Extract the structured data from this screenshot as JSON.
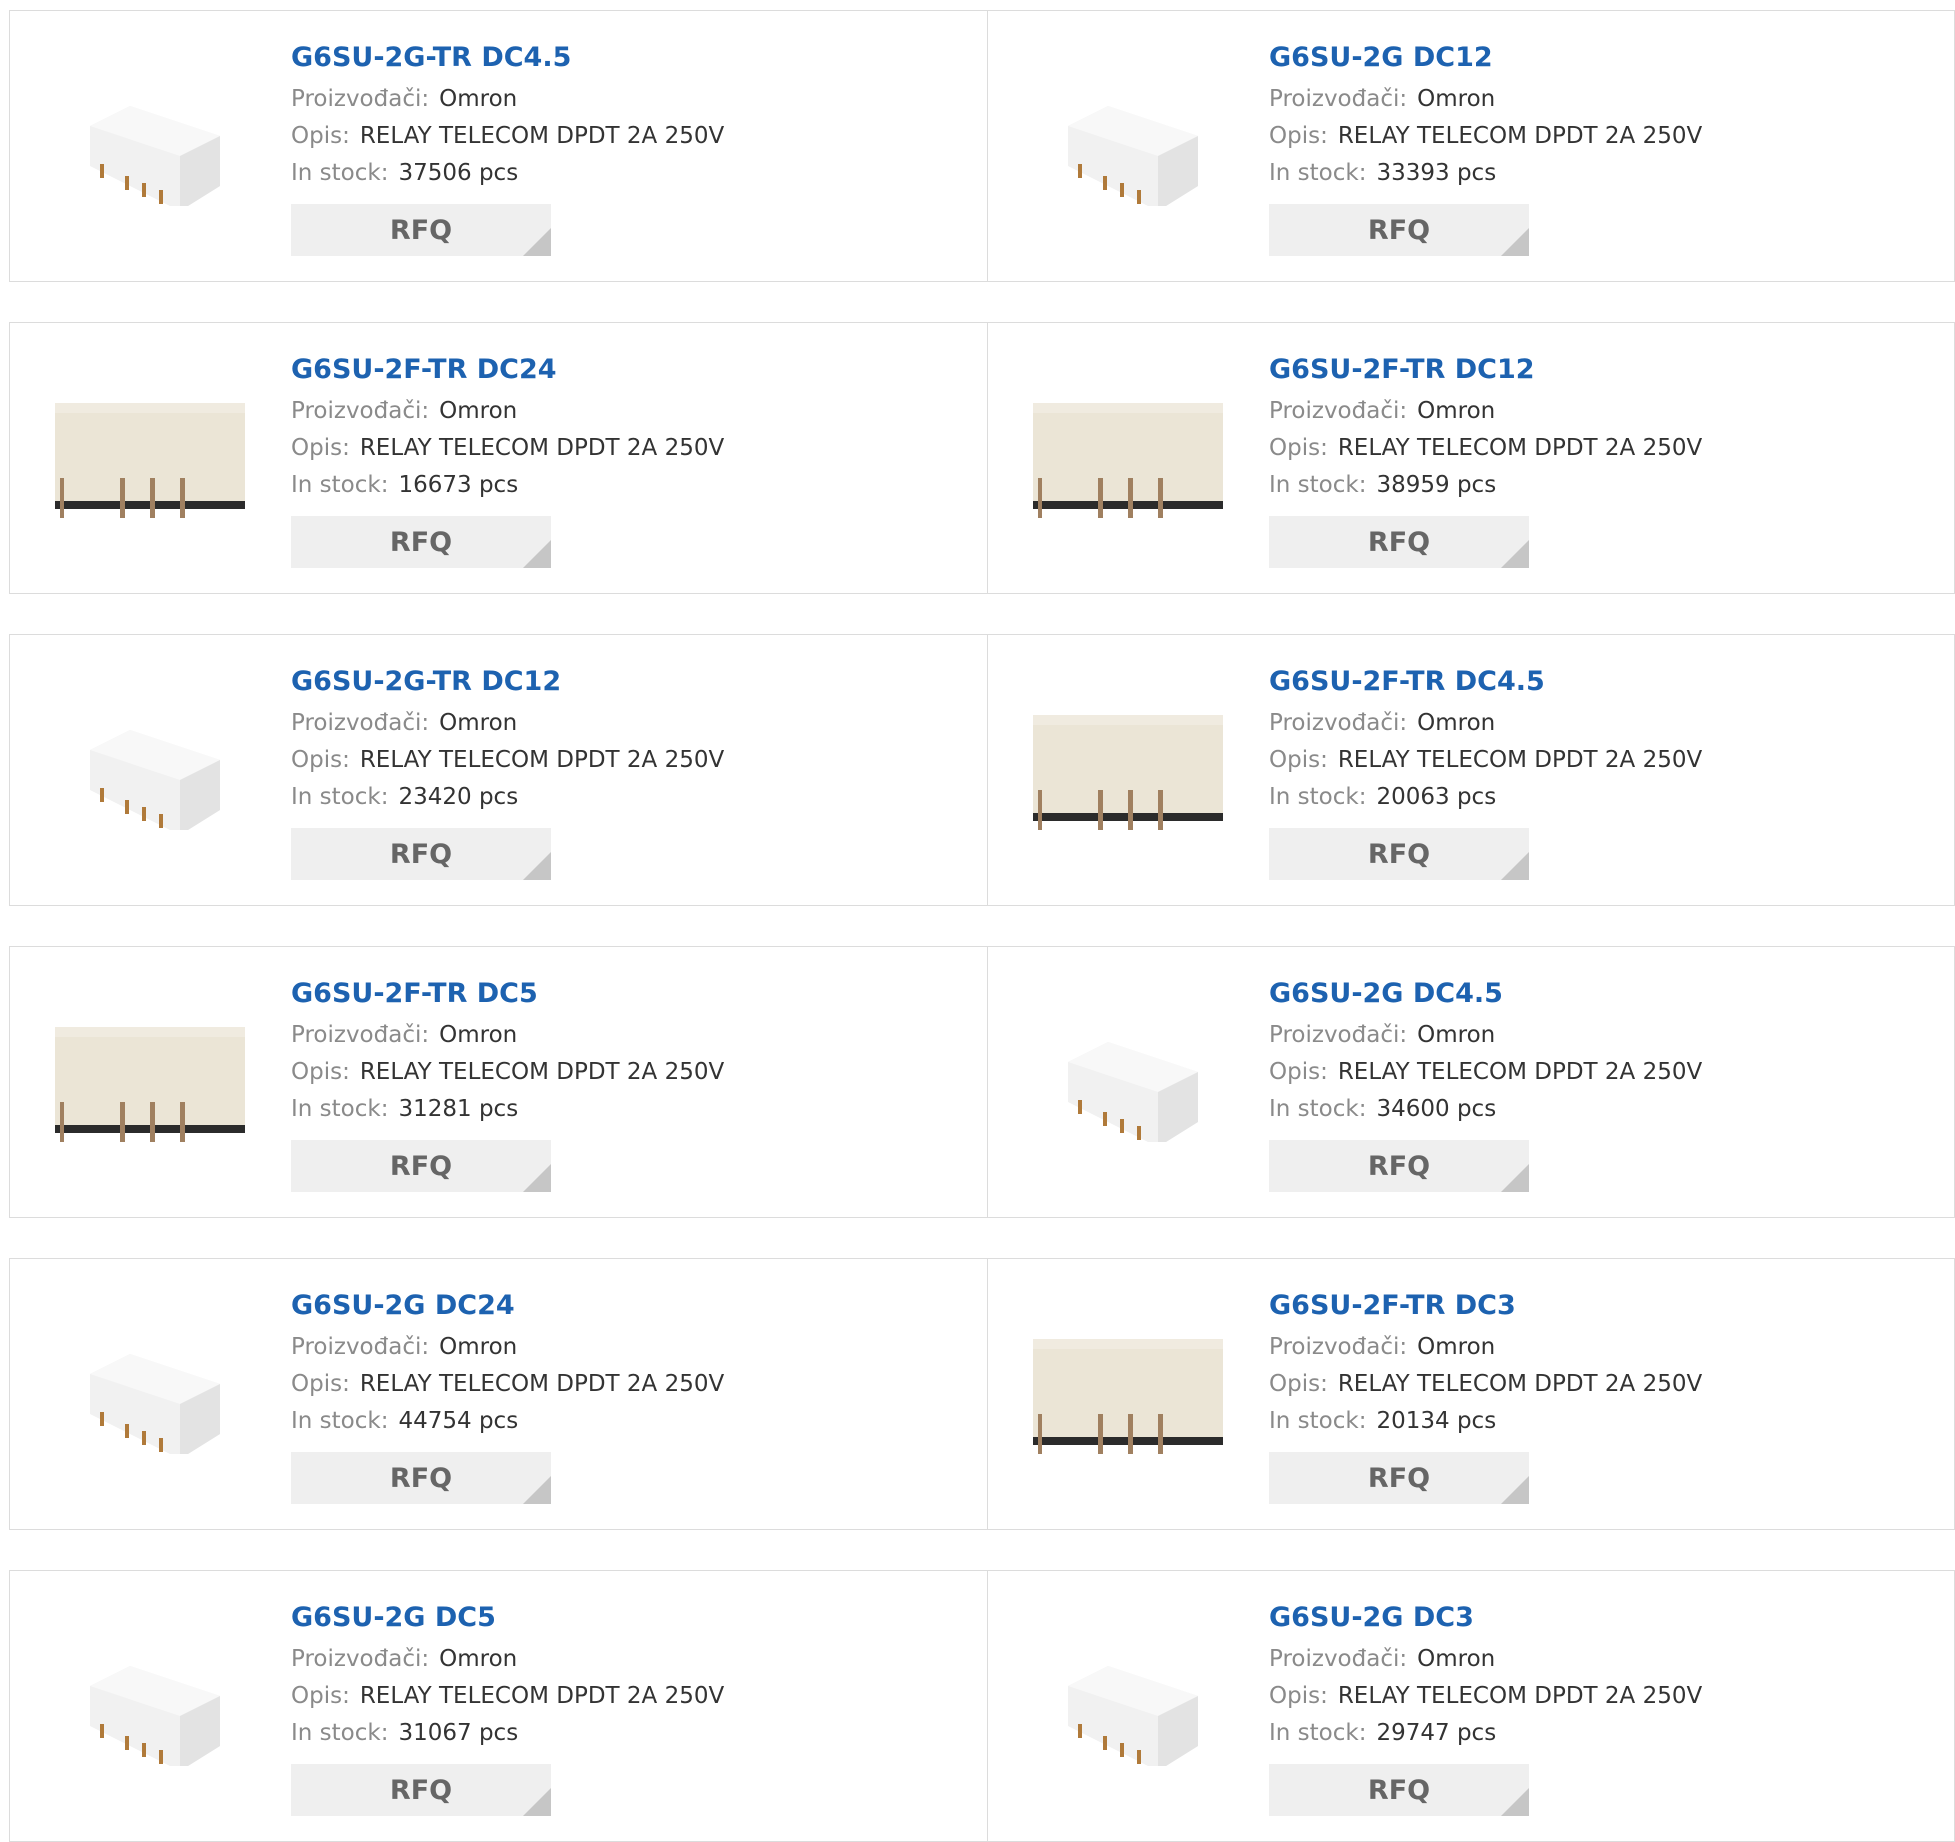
{
  "labels": {
    "manufacturer": "Proizvođači:",
    "description": "Opis:",
    "stock": "In stock:",
    "rfq": "RFQ"
  },
  "rows": [
    [
      {
        "title": "G6SU-2G-TR DC4.5",
        "manufacturer": "Omron",
        "description": "RELAY TELECOM DPDT 2A 250V",
        "stock": "37506 pcs",
        "image": "relay-white"
      },
      {
        "title": "G6SU-2G DC12",
        "manufacturer": "Omron",
        "description": "RELAY TELECOM DPDT 2A 250V",
        "stock": "33393 pcs",
        "image": "relay-white"
      }
    ],
    [
      {
        "title": "G6SU-2F-TR DC24",
        "manufacturer": "Omron",
        "description": "RELAY TELECOM DPDT 2A 250V",
        "stock": "16673 pcs",
        "image": "relay-beige"
      },
      {
        "title": "G6SU-2F-TR DC12",
        "manufacturer": "Omron",
        "description": "RELAY TELECOM DPDT 2A 250V",
        "stock": "38959 pcs",
        "image": "relay-beige"
      }
    ],
    [
      {
        "title": "G6SU-2G-TR DC12",
        "manufacturer": "Omron",
        "description": "RELAY TELECOM DPDT 2A 250V",
        "stock": "23420 pcs",
        "image": "relay-white"
      },
      {
        "title": "G6SU-2F-TR DC4.5",
        "manufacturer": "Omron",
        "description": "RELAY TELECOM DPDT 2A 250V",
        "stock": "20063 pcs",
        "image": "relay-beige"
      }
    ],
    [
      {
        "title": "G6SU-2F-TR DC5",
        "manufacturer": "Omron",
        "description": "RELAY TELECOM DPDT 2A 250V",
        "stock": "31281 pcs",
        "image": "relay-beige"
      },
      {
        "title": "G6SU-2G DC4.5",
        "manufacturer": "Omron",
        "description": "RELAY TELECOM DPDT 2A 250V",
        "stock": "34600 pcs",
        "image": "relay-white"
      }
    ],
    [
      {
        "title": "G6SU-2G DC24",
        "manufacturer": "Omron",
        "description": "RELAY TELECOM DPDT 2A 250V",
        "stock": "44754 pcs",
        "image": "relay-white"
      },
      {
        "title": "G6SU-2F-TR DC3",
        "manufacturer": "Omron",
        "description": "RELAY TELECOM DPDT 2A 250V",
        "stock": "20134 pcs",
        "image": "relay-beige"
      }
    ],
    [
      {
        "title": "G6SU-2G DC5",
        "manufacturer": "Omron",
        "description": "RELAY TELECOM DPDT 2A 250V",
        "stock": "31067 pcs",
        "image": "relay-white"
      },
      {
        "title": "G6SU-2G DC3",
        "manufacturer": "Omron",
        "description": "RELAY TELECOM DPDT 2A 250V",
        "stock": "29747 pcs",
        "image": "relay-white"
      }
    ]
  ]
}
